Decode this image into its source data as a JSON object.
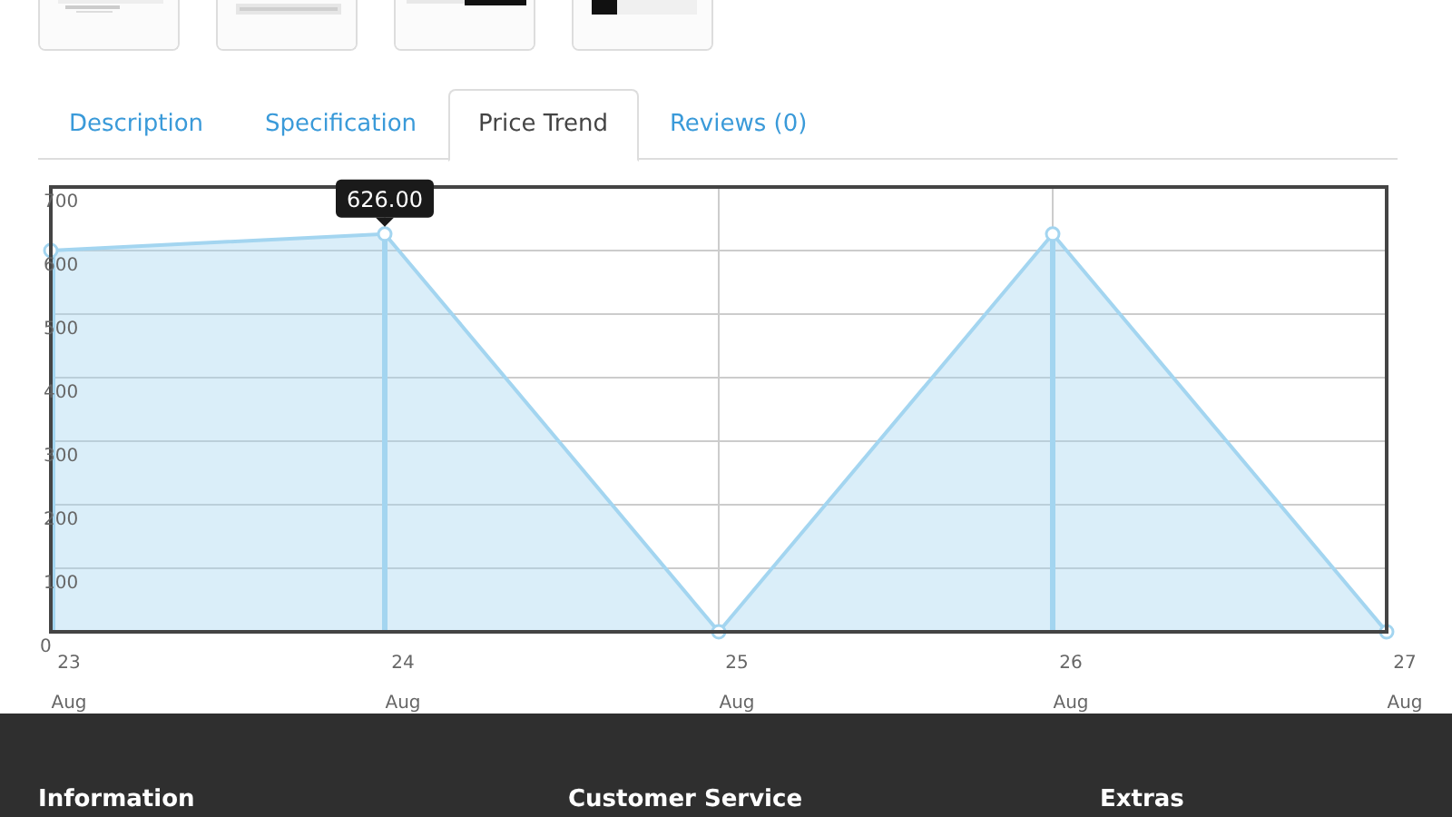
{
  "tabs": [
    {
      "label": "Description",
      "selected": false
    },
    {
      "label": "Specification",
      "selected": false
    },
    {
      "label": "Price Trend",
      "selected": true
    },
    {
      "label": "Reviews (0)",
      "selected": false
    }
  ],
  "chart_data": {
    "type": "area",
    "categories": [
      "23 Aug",
      "24 Aug",
      "25 Aug",
      "26 Aug",
      "27 Aug"
    ],
    "series": [
      {
        "color": "#a3d5f0",
        "values": [
          600,
          626,
          0,
          626,
          0
        ]
      }
    ],
    "grid": true,
    "ylim": [
      0,
      700
    ],
    "yticks": [
      0,
      100,
      200,
      300,
      400,
      500,
      600,
      700
    ],
    "annotations": [
      "626.00"
    ],
    "ref_lines": [
      {
        "axis": "x",
        "value": "23 Aug",
        "color": "#a3d5f0"
      },
      {
        "axis": "x",
        "value": "24 Aug",
        "color": "#a3d5f0"
      },
      {
        "axis": "x",
        "value": "26 Aug",
        "color": "#a3d5f0"
      }
    ]
  },
  "footer": {
    "headings": [
      "Information",
      "Customer Service",
      "Extras"
    ]
  }
}
